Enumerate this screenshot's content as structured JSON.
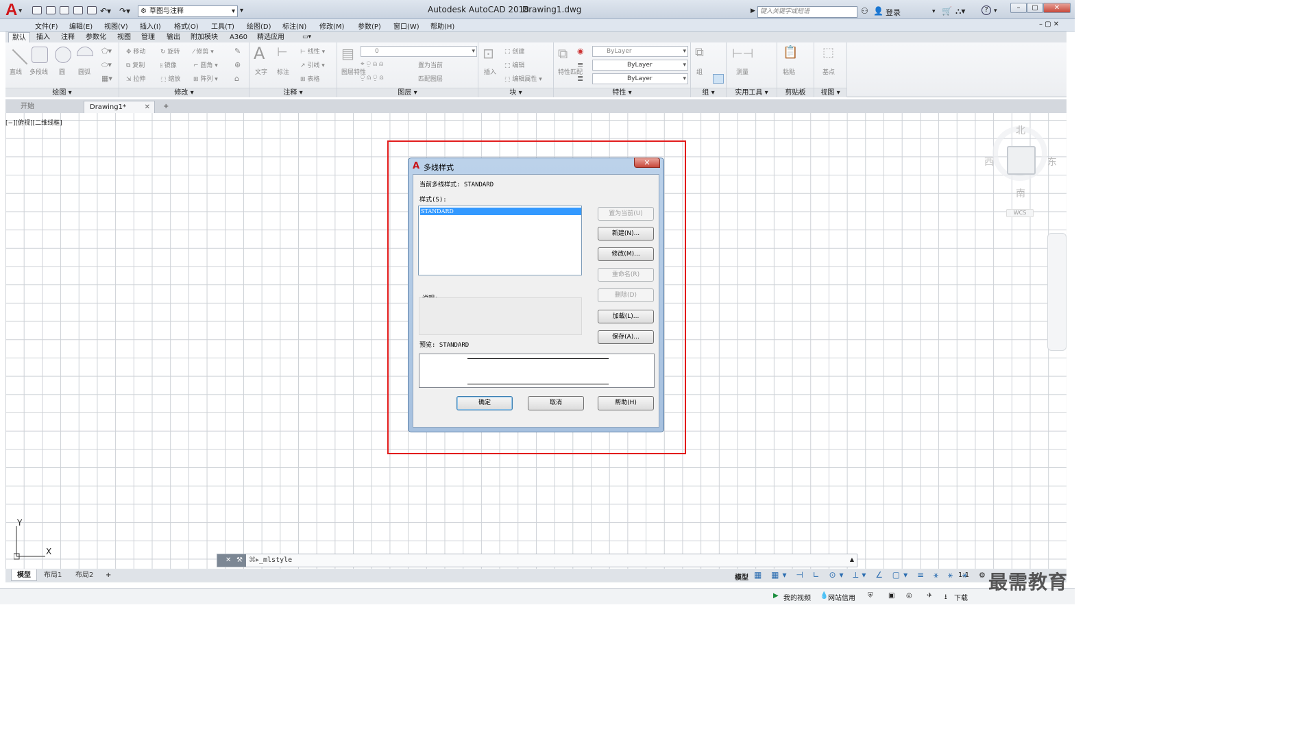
{
  "app": {
    "title": "Autodesk AutoCAD 2018",
    "document": "Drawing1.dwg",
    "workspace": "草图与注释",
    "search_placeholder": "键入关键字或短语",
    "login": "登录"
  },
  "menu": [
    "文件(F)",
    "编辑(E)",
    "视图(V)",
    "插入(I)",
    "格式(O)",
    "工具(T)",
    "绘图(D)",
    "标注(N)",
    "修改(M)",
    "参数(P)",
    "窗口(W)",
    "帮助(H)"
  ],
  "ribbon_tabs": [
    "默认",
    "插入",
    "注释",
    "参数化",
    "视图",
    "管理",
    "输出",
    "附加模块",
    "A360",
    "精选应用"
  ],
  "ribbon_groups": [
    {
      "name": "绘图",
      "tools": [
        "直线",
        "多段线",
        "圆",
        "圆弧"
      ]
    },
    {
      "name": "修改",
      "tools": [
        "移动",
        "旋转",
        "修剪",
        "复制",
        "镜像",
        "圆角",
        "拉伸",
        "缩放",
        "阵列"
      ]
    },
    {
      "name": "注释",
      "tools": [
        "文字",
        "标注",
        "线性",
        "引线",
        "表格"
      ]
    },
    {
      "name": "图层",
      "tools": [
        "图层特性",
        "置为当前",
        "匹配图层"
      ],
      "layer": "0"
    },
    {
      "name": "块",
      "tools": [
        "插入",
        "创建",
        "编辑",
        "编辑属性"
      ]
    },
    {
      "name": "特性",
      "tools": [
        "特性匹配"
      ],
      "color": "ByLayer",
      "linetype": "ByLayer",
      "lineweight": "ByLayer"
    },
    {
      "name": "组",
      "tools": [
        "组"
      ]
    },
    {
      "name": "实用工具",
      "tools": [
        "测量"
      ]
    },
    {
      "name": "剪贴板",
      "tools": [
        "粘贴"
      ]
    },
    {
      "name": "视图",
      "tools": [
        "基点"
      ]
    }
  ],
  "file_tabs": [
    "开始",
    "Drawing1*"
  ],
  "viewport_label": "[−][俯视][二维线框]",
  "viewcube": {
    "north": "北",
    "south": "南",
    "east": "东",
    "west": "西",
    "wcs": "WCS"
  },
  "ucs": {
    "x": "X",
    "y": "Y"
  },
  "command_line": "_mlstyle",
  "layout_tabs": [
    "模型",
    "布局1",
    "布局2"
  ],
  "status": {
    "model": "模型",
    "scale": "1:1"
  },
  "taskbar": [
    "我的视频",
    "网站信用",
    "下载"
  ],
  "watermark": "最需教育",
  "dialog": {
    "title": "多线样式",
    "current_style_label": "当前多线样式: STANDARD",
    "styles_label": "样式(S):",
    "styles": [
      "STANDARD"
    ],
    "description_label": "说明:",
    "preview_label": "预览: STANDARD",
    "buttons": {
      "set_current": "置为当前(U)",
      "new": "新建(N)...",
      "modify": "修改(M)...",
      "rename": "重命名(R)",
      "delete": "删除(D)",
      "load": "加载(L)...",
      "save": "保存(A)..."
    },
    "ok": "确定",
    "cancel": "取消",
    "help": "帮助(H)"
  }
}
